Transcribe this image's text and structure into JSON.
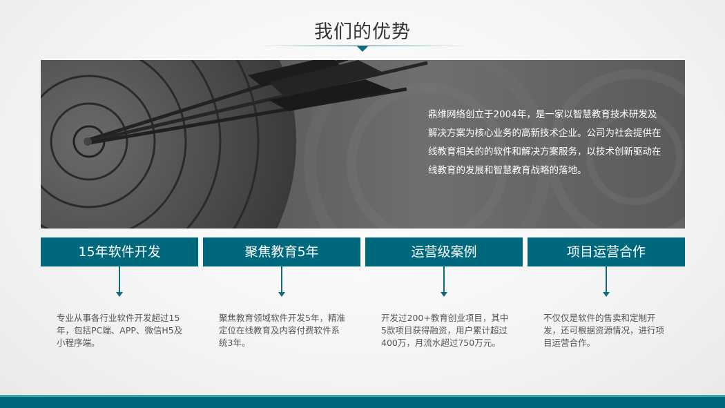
{
  "page": {
    "title": "我们的优势",
    "accent_color": "#00687d"
  },
  "hero": {
    "image": "archery-target-arrows",
    "description": "鼎维网络创立于2004年，是一家以智慧教育技术研发及解决方案为核心业务的高新技术企业。公司为社会提供在线教育相关的的软件和解决方案服务，以技术创新驱动在线教育的发展和智慧教育战略的落地。"
  },
  "features": [
    {
      "title": "15年软件开发",
      "body": "专业从事各行业软件开发超过15年，包括PC端、APP、微信H5及小程序端。"
    },
    {
      "title": "聚焦教育5年",
      "body": "聚焦教育领域软件开发5年，精准定位在线教育及内容付费软件系统3年。"
    },
    {
      "title": "运营级案例",
      "body": "开发过200+教育创业项目，其中5款项目获得融资，用户累计超过400万，月流水超过750万元。"
    },
    {
      "title": "项目运营合作",
      "body": "不仅仅是软件的售卖和定制开发，还可根据资源情况，进行项目运营合作。"
    }
  ]
}
